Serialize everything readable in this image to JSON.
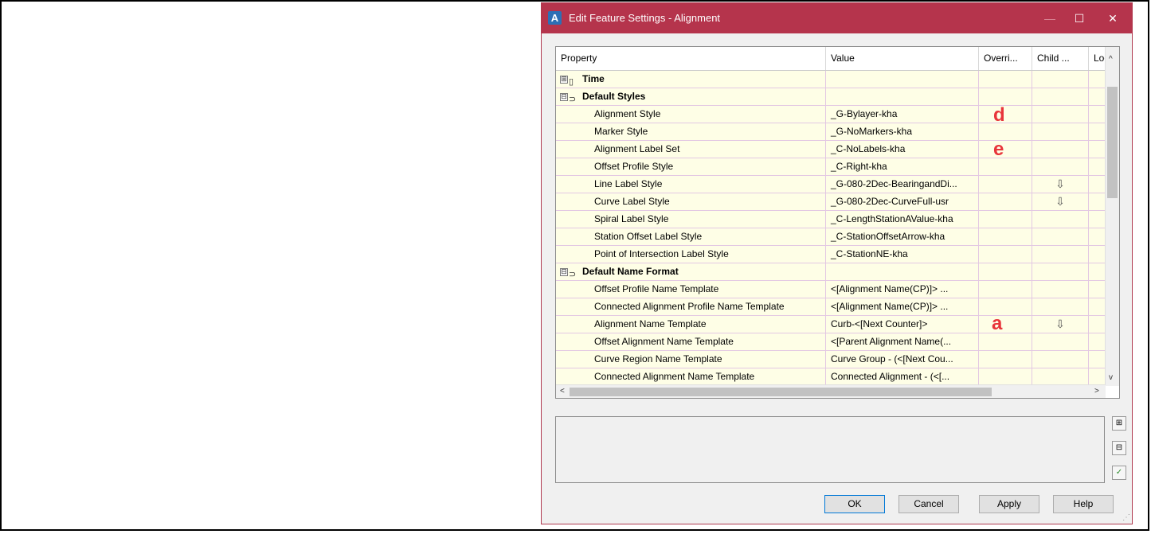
{
  "window": {
    "app_icon": "A",
    "title": "Edit Feature Settings - Alignment",
    "minimize": "—",
    "maximize": "☐",
    "close": "✕"
  },
  "columns": [
    "Property",
    "Value",
    "Overri...",
    "Child ...",
    "Lock"
  ],
  "rows": [
    {
      "type": "group",
      "expander": "⊞",
      "icon": "page-icon",
      "label": "Time",
      "value": "",
      "child": "",
      "lock": ""
    },
    {
      "type": "group",
      "expander": "⊟",
      "icon": "style-group-icon",
      "label": "Default Styles",
      "value": "",
      "child": "",
      "lock": ""
    },
    {
      "type": "item",
      "label": "Alignment Style",
      "value": "_G-Bylayer-kha",
      "child": "",
      "lock": "🔓"
    },
    {
      "type": "item",
      "label": "Marker Style",
      "value": "_G-NoMarkers-kha",
      "child": "",
      "lock": "🔓"
    },
    {
      "type": "item",
      "label": "Alignment Label Set",
      "value": "_C-NoLabels-kha",
      "child": "",
      "lock": "🔓"
    },
    {
      "type": "item",
      "label": "Offset Profile Style",
      "value": "_C-Right-kha",
      "child": "",
      "lock": "🔓"
    },
    {
      "type": "item",
      "label": "Line Label Style",
      "value": "_G-080-2Dec-BearingandDi...",
      "child": "⇩",
      "lock": "🔓"
    },
    {
      "type": "item",
      "label": "Curve Label Style",
      "value": "_G-080-2Dec-CurveFull-usr",
      "child": "⇩",
      "lock": "🔓"
    },
    {
      "type": "item",
      "label": "Spiral Label Style",
      "value": "_C-LengthStationAValue-kha",
      "child": "",
      "lock": "🔓"
    },
    {
      "type": "item",
      "label": "Station Offset Label Style",
      "value": "_C-StationOffsetArrow-kha",
      "child": "",
      "lock": "🔓"
    },
    {
      "type": "item",
      "label": "Point of Intersection Label Style",
      "value": "_C-StationNE-kha",
      "child": "",
      "lock": "🔓"
    },
    {
      "type": "group",
      "expander": "⊟",
      "icon": "style-group-icon",
      "label": "Default Name Format",
      "value": "",
      "child": "",
      "lock": ""
    },
    {
      "type": "item",
      "label": "Offset Profile Name Template",
      "value": "<[Alignment Name(CP)]> ...",
      "child": "",
      "lock": "🔓"
    },
    {
      "type": "item",
      "label": "Connected Alignment Profile Name Template",
      "value": "<[Alignment Name(CP)]> ...",
      "child": "",
      "lock": "🔓"
    },
    {
      "type": "item",
      "label": "Alignment Name Template",
      "value": "Curb-<[Next Counter]>",
      "child": "⇩",
      "lock": "🔓"
    },
    {
      "type": "item",
      "label": "Offset Alignment Name Template",
      "value": "<[Parent Alignment Name(...",
      "child": "",
      "lock": "🔓"
    },
    {
      "type": "item",
      "label": "Curve Region Name Template",
      "value": "Curve Group - (<[Next Cou...",
      "child": "",
      "lock": "🔓"
    },
    {
      "type": "item",
      "label": "Connected Alignment Name Template",
      "value": "Connected Alignment - (<[...",
      "child": "",
      "lock": "🔓"
    }
  ],
  "annotations": {
    "d": "d",
    "e": "e",
    "a": "a"
  },
  "buttons": {
    "ok": "OK",
    "cancel": "Cancel",
    "apply": "Apply",
    "help": "Help"
  }
}
